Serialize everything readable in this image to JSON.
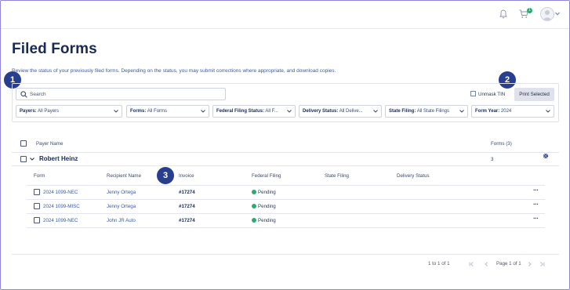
{
  "header": {
    "bell_icon": "bell-icon",
    "cart_icon": "cart-icon",
    "cart_badge": "1",
    "avatar_icon": "user-avatar-icon"
  },
  "page": {
    "title": "Filed Forms",
    "description": "Review the status of your previously filed forms. Depending on the status, you may submit corrections where appropriate, and download copies."
  },
  "callouts": [
    "1",
    "2",
    "3"
  ],
  "search": {
    "placeholder": "Search"
  },
  "unmask_label": "Unmask TIN",
  "print_label": "Print Selected",
  "filters": [
    {
      "label": "Payers:",
      "value": "All Payers"
    },
    {
      "label": "Forms:",
      "value": "All Forms"
    },
    {
      "label": "Federal Filing Status:",
      "value": "All F..."
    },
    {
      "label": "Delivery Status:",
      "value": "All Delive..."
    },
    {
      "label": "State Filing:",
      "value": "All State Filings"
    },
    {
      "label": "Form Year:",
      "value": "2024"
    }
  ],
  "table": {
    "payer_header": "Payer Name",
    "forms_header": "Forms (3)",
    "group": {
      "name": "Robert Heinz",
      "count": "3"
    },
    "columns": [
      "Form",
      "Recipient Name",
      "Invoice",
      "Federal Filing",
      "State Filing",
      "Delivery Status"
    ],
    "rows": [
      {
        "form": "2024 1099-NEC",
        "recipient": "Jenny Ortega",
        "invoice": "#17274",
        "federal": "Pending"
      },
      {
        "form": "2024 1099-MISC",
        "recipient": "Jenny Ortega",
        "invoice": "#17274",
        "federal": "Pending"
      },
      {
        "form": "2024 1099-NEC",
        "recipient": "John JR Auto",
        "invoice": "#17274",
        "federal": "Pending"
      }
    ],
    "row_menu": "···"
  },
  "pagination": {
    "range": "1 to 1 of 1",
    "page": "Page 1 of 1"
  },
  "colors": {
    "brand": "#283e8f",
    "title": "#1a2a52",
    "link": "#3b5a9e",
    "pending": "#2eaa6f",
    "frame": "#8f86d4"
  }
}
